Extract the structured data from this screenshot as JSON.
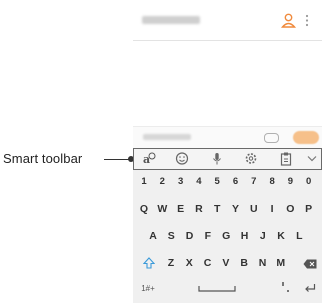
{
  "callout": {
    "label": "Smart toolbar"
  },
  "app_bar": {
    "contact_icon": "person-icon",
    "more_icon": "more-vert-icon"
  },
  "composer": {
    "attach_icon": "attach-icon",
    "send_color": "#f6c08a"
  },
  "smart_toolbar": {
    "items": [
      {
        "name": "translate-icon"
      },
      {
        "name": "emoji-icon"
      },
      {
        "name": "microphone-icon"
      },
      {
        "name": "settings-icon"
      },
      {
        "name": "clipboard-icon"
      },
      {
        "name": "chevron-down-icon"
      }
    ]
  },
  "keyboard": {
    "numbers": [
      "1",
      "2",
      "3",
      "4",
      "5",
      "6",
      "7",
      "8",
      "9",
      "0"
    ],
    "row1": [
      "Q",
      "W",
      "E",
      "R",
      "T",
      "Y",
      "U",
      "I",
      "O",
      "P"
    ],
    "row2": [
      "A",
      "S",
      "D",
      "F",
      "G",
      "H",
      "J",
      "K",
      "L"
    ],
    "row3": [
      "Z",
      "X",
      "C",
      "V",
      "B",
      "N",
      "M"
    ],
    "symbols_label": "1#+",
    "shift_icon": "shift-icon",
    "backspace_icon": "backspace-icon",
    "space_icon": "space-icon",
    "enter_icon": "enter-icon",
    "accent_color": "#3a9ad9"
  }
}
